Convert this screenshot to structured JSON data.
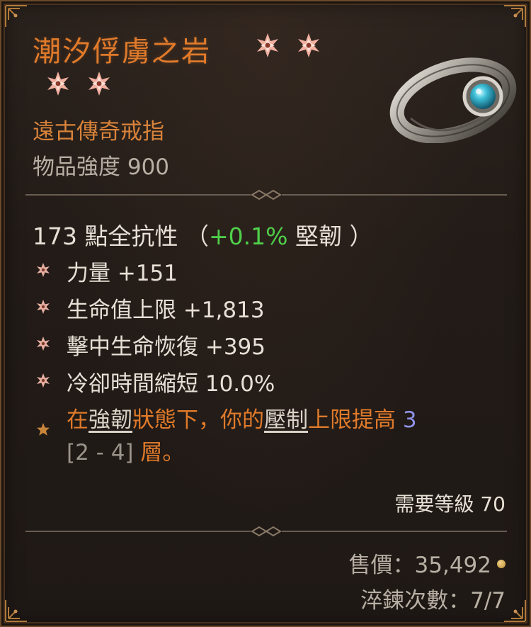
{
  "item": {
    "name": "潮汐俘虜之岩",
    "type": "遠古傳奇戒指",
    "item_power": "物品強度 900",
    "stars_count": 4,
    "base_stat": {
      "main": "173 點全抗性",
      "paren_open": "（",
      "bonus": "+0.1%",
      "bonus_label": "堅韌",
      "paren_close": "）"
    },
    "affixes": [
      {
        "label": "力量 +151"
      },
      {
        "label": "生命值上限 +1,813"
      },
      {
        "label": "擊中生命恢復 +395"
      },
      {
        "label": "冷卻時間縮短 10.0%"
      }
    ],
    "legendary": {
      "part1": "在",
      "keyword1": "強韌",
      "part2": "狀態下，你的",
      "keyword2": "壓制",
      "part3": "上限提高",
      "value": "3",
      "range": "[2 - 4]",
      "part4": "層。"
    },
    "required_level": "需要等級 70",
    "sell_price": "售價：35,492",
    "temper": "淬鍊次數：7/7"
  },
  "colors": {
    "title": "#e07a2a",
    "bonus_green": "#4fd04a",
    "value_blue": "#8f93e8",
    "star_pink": "#f1b0a0"
  },
  "icons": [
    "greater-affix-star-icon",
    "affix-bullet-icon",
    "legendary-star-icon",
    "gold-coin-icon",
    "ring-item-icon"
  ]
}
